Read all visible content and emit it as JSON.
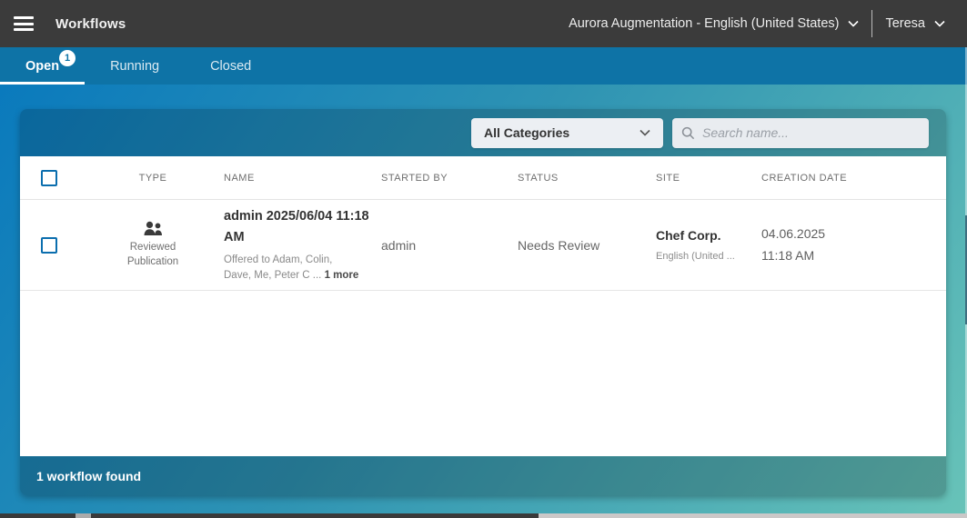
{
  "header": {
    "title": "Workflows",
    "project_selector": "Aurora Augmentation - English (United States)",
    "user_name": "Teresa"
  },
  "tabs": [
    {
      "label": "Open",
      "badge": "1",
      "active": true
    },
    {
      "label": "Running",
      "active": false
    },
    {
      "label": "Closed",
      "active": false
    }
  ],
  "filters": {
    "category_dropdown": "All Categories",
    "search_placeholder": "Search name..."
  },
  "table": {
    "columns": [
      "TYPE",
      "NAME",
      "STARTED BY",
      "STATUS",
      "SITE",
      "CREATION DATE"
    ],
    "rows": [
      {
        "type_icon": "people-icon",
        "type_label": "Reviewed Publication",
        "name": "admin 2025/06/04 11:18 AM",
        "name_sub": "Offered to Adam, Colin, Dave, Me, Peter C ...",
        "name_sub_more": "1 more",
        "started_by": "admin",
        "status": "Needs Review",
        "site": "Chef Corp.",
        "site_sub": "English (United ...",
        "creation_date": "04.06.2025",
        "creation_time": "11:18 AM"
      }
    ]
  },
  "footer": {
    "summary": "1 workflow found"
  },
  "colors": {
    "topbar": "#3B3B3B",
    "tabbar": "#0E73A6",
    "gradient_start": "#0A7ABD",
    "gradient_end": "#68C3B8",
    "accent_blue": "#0B6EAE"
  }
}
